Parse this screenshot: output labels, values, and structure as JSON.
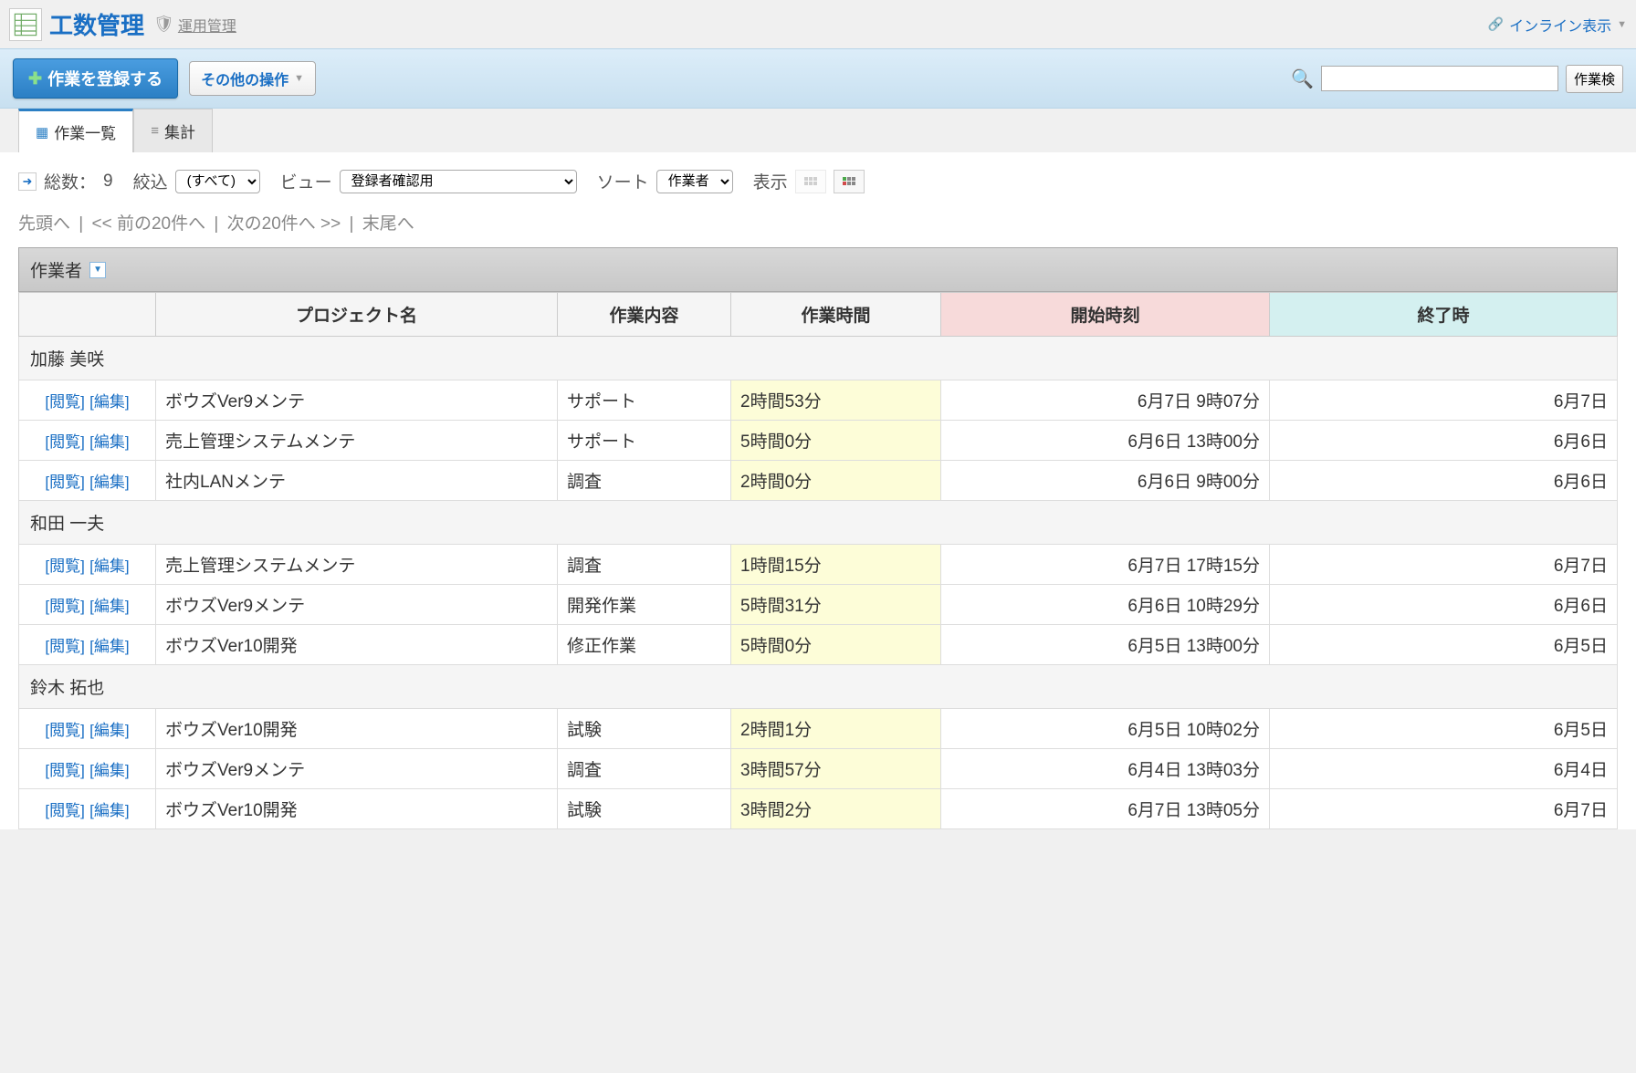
{
  "header": {
    "title": "工数管理",
    "admin": "運用管理",
    "inline_link": "インライン表示"
  },
  "toolbar": {
    "register": "作業を登録する",
    "other_ops": "その他の操作",
    "search_btn": "作業検"
  },
  "tabs": {
    "list": "作業一覧",
    "aggregate": "集計"
  },
  "filters": {
    "total_label": "総数：",
    "total_count": "9",
    "filter_label": "絞込",
    "filter_value": "(すべて)",
    "view_label": "ビュー",
    "view_value": "登録者確認用",
    "sort_label": "ソート",
    "sort_value": "作業者",
    "display_label": "表示"
  },
  "pager": {
    "first": "先頭へ",
    "prev": "<< 前の20件へ",
    "next": "次の20件へ >>",
    "last": "末尾へ"
  },
  "grouping_label": "作業者",
  "columns": {
    "project": "プロジェクト名",
    "task": "作業内容",
    "time": "作業時間",
    "start": "開始時刻",
    "end": "終了時"
  },
  "actions": {
    "view": "[閲覧]",
    "edit": "[編集]"
  },
  "groups": [
    {
      "name": "加藤 美咲",
      "rows": [
        {
          "project": "ボウズVer9メンテ",
          "task": "サポート",
          "time": "2時間53分",
          "start": "6月7日 9時07分",
          "end": "6月7日"
        },
        {
          "project": "売上管理システムメンテ",
          "task": "サポート",
          "time": "5時間0分",
          "start": "6月6日 13時00分",
          "end": "6月6日"
        },
        {
          "project": "社内LANメンテ",
          "task": "調査",
          "time": "2時間0分",
          "start": "6月6日 9時00分",
          "end": "6月6日"
        }
      ]
    },
    {
      "name": "和田 一夫",
      "rows": [
        {
          "project": "売上管理システムメンテ",
          "task": "調査",
          "time": "1時間15分",
          "start": "6月7日 17時15分",
          "end": "6月7日"
        },
        {
          "project": "ボウズVer9メンテ",
          "task": "開発作業",
          "time": "5時間31分",
          "start": "6月6日 10時29分",
          "end": "6月6日"
        },
        {
          "project": "ボウズVer10開発",
          "task": "修正作業",
          "time": "5時間0分",
          "start": "6月5日 13時00分",
          "end": "6月5日"
        }
      ]
    },
    {
      "name": "鈴木 拓也",
      "rows": [
        {
          "project": "ボウズVer10開発",
          "task": "試験",
          "time": "2時間1分",
          "start": "6月5日 10時02分",
          "end": "6月5日"
        },
        {
          "project": "ボウズVer9メンテ",
          "task": "調査",
          "time": "3時間57分",
          "start": "6月4日 13時03分",
          "end": "6月4日"
        },
        {
          "project": "ボウズVer10開発",
          "task": "試験",
          "time": "3時間2分",
          "start": "6月7日 13時05分",
          "end": "6月7日"
        }
      ]
    }
  ]
}
